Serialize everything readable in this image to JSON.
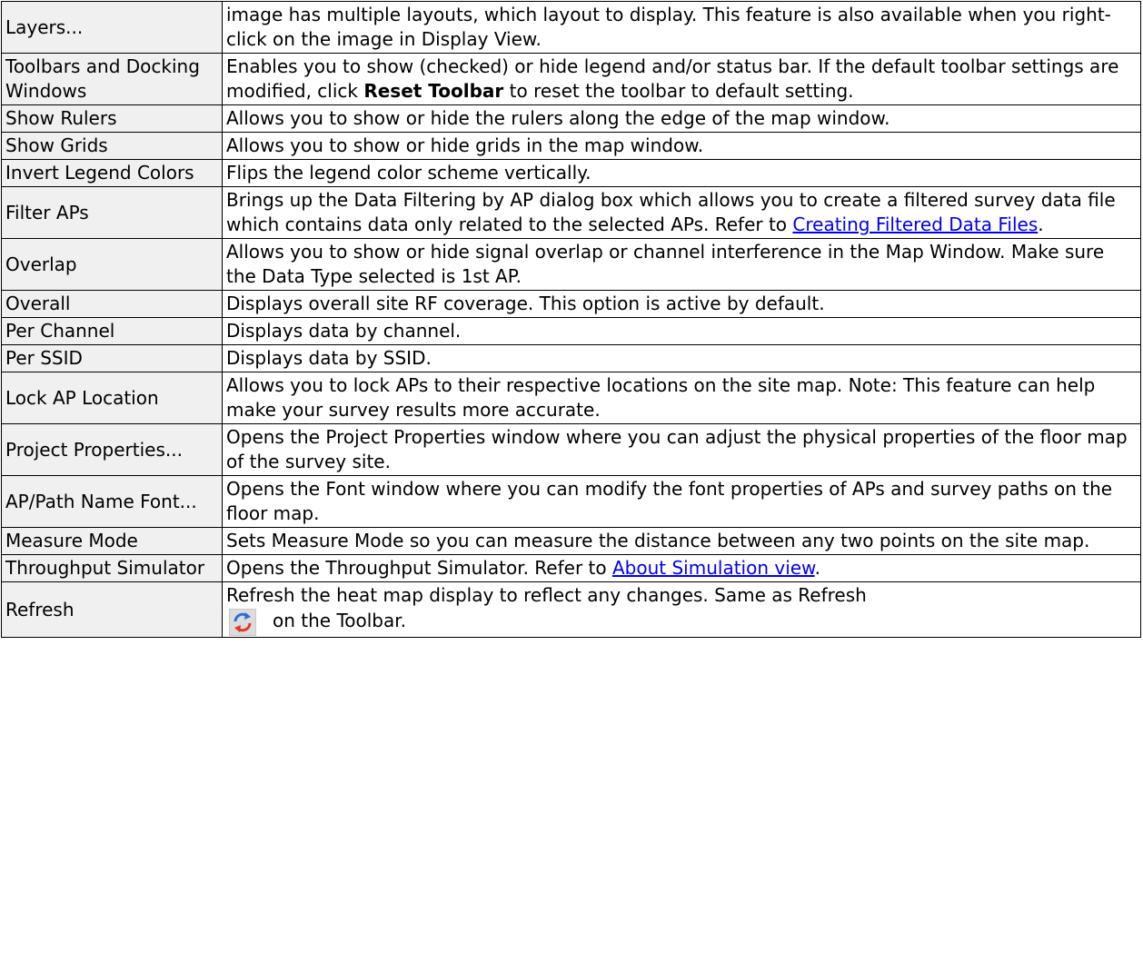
{
  "rows": [
    {
      "cmd": "Layers...",
      "desc": "image has multiple layouts, which layout to display. This feature is also available when you right-click on the image in Display View."
    },
    {
      "cmd": "Toolbars and Docking Windows",
      "desc_a": "Enables you to show (checked) or hide legend and/or status bar. If the default toolbar settings are modified, click ",
      "desc_bold": "Reset Toolbar",
      "desc_b": " to reset the toolbar to default setting."
    },
    {
      "cmd": "Show Rulers",
      "desc": "Allows you to show or hide the rulers along the edge of the map window."
    },
    {
      "cmd": "Show Grids",
      "desc": "Allows you to show or hide grids in the map window."
    },
    {
      "cmd": "Invert Legend Colors",
      "desc": "Flips the legend color scheme vertically."
    },
    {
      "cmd": "Filter APs",
      "desc_a": "Brings up the Data Filtering by AP dialog box which allows you to create a filtered survey data file which contains data only related to the selected APs. Refer to ",
      "link": "Creating Filtered Data Files",
      "desc_b": "."
    },
    {
      "cmd": "Overlap",
      "desc": "Allows you to show or hide signal overlap or channel interference in the Map Window. Make sure the Data Type selected is 1st AP."
    },
    {
      "cmd": "Overall",
      "desc": "Displays overall site RF coverage. This option is active by default."
    },
    {
      "cmd": "Per Channel",
      "desc": "Displays data by channel."
    },
    {
      "cmd": "Per SSID",
      "desc": "Displays data by SSID."
    },
    {
      "cmd": "Lock AP Location",
      "desc": "Allows you to lock APs to their respective locations on the site map. Note: This feature can help make your survey results more accurate."
    },
    {
      "cmd": "Project Properties...",
      "desc": "Opens the Project Properties window where you can adjust the physical properties of the floor map of the survey site."
    },
    {
      "cmd": "AP/Path Name Font...",
      "desc": "Opens the Font window where you can modify the font properties of APs and survey paths on the floor map."
    },
    {
      "cmd": "Measure Mode",
      "desc": "Sets Measure Mode so you can measure the distance between any two points on the site map."
    },
    {
      "cmd": "Throughput Simulator",
      "desc_a": "Opens the Throughput Simulator. Refer to ",
      "link": "About Simulation view",
      "desc_b": "."
    },
    {
      "cmd": "Refresh",
      "desc_a": "Refresh the heat map display to reflect any changes. Same as Refresh",
      "icon": "refresh-icon",
      "desc_b": "on the Toolbar."
    }
  ],
  "colors": {
    "command_cell_bg": "#f0f0f0",
    "link": "#0000ee",
    "border": "#000000"
  }
}
